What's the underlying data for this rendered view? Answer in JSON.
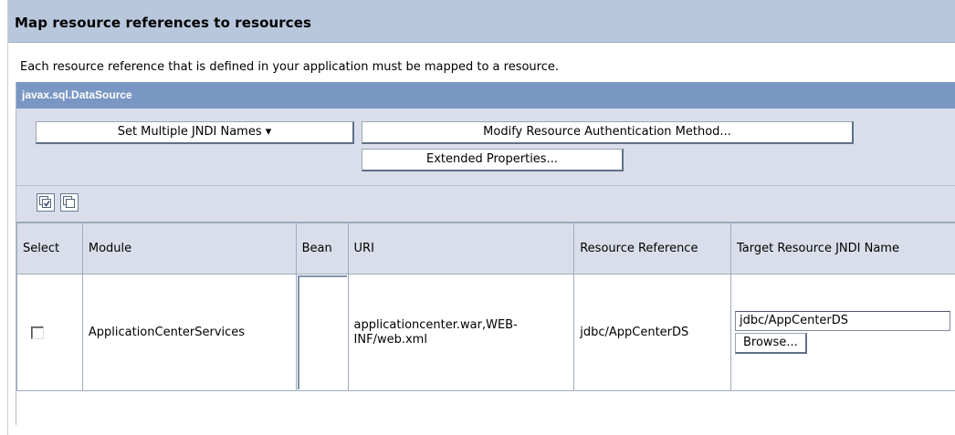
{
  "header": {
    "title": "Map resource references to resources"
  },
  "description": "Each resource reference that is defined in your application must be mapped to a resource.",
  "panel": {
    "title": "javax.sql.DataSource",
    "buttons": {
      "set_multiple_jndi": "Set Multiple JNDI Names ▾",
      "modify_auth": "Modify Resource Authentication Method...",
      "extended_props": "Extended Properties..."
    },
    "icons": [
      "select-all-icon",
      "deselect-all-icon"
    ]
  },
  "table": {
    "columns": {
      "select": "Select",
      "module": "Module",
      "bean": "Bean",
      "uri": "URI",
      "resource_reference": "Resource Reference",
      "target_jndi": "Target Resource JNDI Name"
    },
    "rows": [
      {
        "selected": false,
        "module": "ApplicationCenterServices",
        "bean": "",
        "uri": "applicationcenter.war,WEB-INF/web.xml",
        "resource_reference": "jdbc/AppCenterDS",
        "target_jndi_value": "jdbc/AppCenterDS",
        "browse_label": "Browse..."
      }
    ]
  }
}
